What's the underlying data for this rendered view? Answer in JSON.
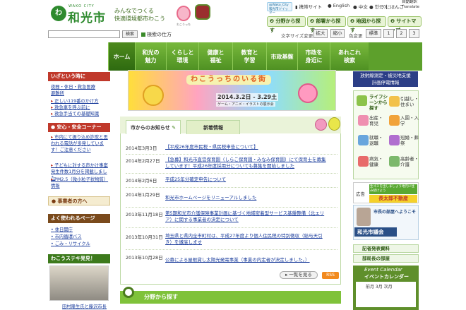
{
  "header": {
    "logo_roman": "WAKO CITY",
    "logo_kanji": "和光市",
    "logo_mark": "わ",
    "tagline_1": "みんなでつくる",
    "tagline_2": "快適環境都市わこう",
    "mascot_caption": "わこうっち"
  },
  "utility": {
    "twitter_1": "@Wako_City",
    "twitter_2": "和光市ツイッター",
    "mobile": "携帯サイト",
    "english": "English",
    "chinese": "中文",
    "korean": "한국어",
    "japanese": "にほんご",
    "translate_1": "自動翻訳",
    "translate_2": "Translate",
    "bunya": "分野から探す",
    "busho": "部署から探す",
    "chizu": "地図から探す",
    "sitemap": "サイトマップ"
  },
  "search": {
    "button": "検索",
    "help": "検索の仕方"
  },
  "font_size": {
    "label": "文字サイズ変更",
    "large": "拡大",
    "small": "縮小"
  },
  "color": {
    "label": "色変更",
    "standard": "標準",
    "opt1": "1",
    "opt2": "2",
    "opt3": "3"
  },
  "nav": [
    "ホーム",
    "和光の\n魅力",
    "くらしと\n環境",
    "健康と\n福祉",
    "教育と\n学習",
    "市政基盤",
    "市政を\n身近に",
    "あれこれ\n検索"
  ],
  "left": {
    "emergency_head": "いざという時に",
    "emergency_links": [
      "夜間・休日・救急医療",
      "避難所"
    ],
    "emergency_items": [
      "正しい119番のかけ方",
      "救急車を呼ぶ前に",
      "救急手当ての基礎知識"
    ],
    "safety_head": "安心・安全コーナー",
    "safety_items": [
      "市内にて振り込め詐欺と思われる電話が多発しています！ご注意ください",
      "子どもに対する声かけ事案発生件数1月分を掲載しました",
      "PM2.5（微小粒子状物質）情報"
    ],
    "business_head": "事業者の方へ",
    "visit_head": "よく使われるページ",
    "visit_items": [
      "休日開庁",
      "市内循環バス",
      "ごみ・リサイクル"
    ],
    "photo_head": "わこうステキ発見！",
    "photo_caption": "田村隆生氏と藤沢市長"
  },
  "banner": {
    "title": "わこうっちのいる街",
    "date": "2014.3.2日 - 3.29土",
    "sub": "ゲーム・アニメ・イラストの展示会"
  },
  "news": {
    "tab1": "市からのお知らせ",
    "tab2": "新着情報",
    "items": [
      {
        "date": "2014年3月3日",
        "text": "【平成26年度市民税・県民税申告について】"
      },
      {
        "date": "2014年2月27日",
        "text": "【急募】和光市直営保育園（しらこ保育園・みなみ保育園）にて保育士を募集しています！平成26年度採用分についても募集を開始しました"
      },
      {
        "date": "2014年2月6日",
        "text": "平成25年分確定申告について"
      },
      {
        "date": "2014年1月29日",
        "text": "和光市ホームページをリニューアルしました"
      },
      {
        "date": "2013年11月18日",
        "text": "第5期和光市介護保険事業計画に基づく地域密着型サービス基盤整備（北エリア）に関する事業者の決定について"
      },
      {
        "date": "2013年10月31日",
        "text": "埼玉県と県内全市町村は、平成27年度より個人住民税の特別徴収（給与天引き）を徹底します"
      },
      {
        "date": "2013年10月28日",
        "text": "公募による屋根貸し太陽光発電事業（事業の内定者が決定しました。）"
      }
    ],
    "more": "一覧を見る",
    "rss": "RSS"
  },
  "field": {
    "title": "分野から探す"
  },
  "right": {
    "disaster_1": "放射線測定・被災地支援",
    "disaster_2": "計画停電情報",
    "life_head": "ライフシーンから探す",
    "life_items": [
      "引越し・住まい",
      "出産・育児",
      "入園・入学",
      "就職・退職",
      "冠婚・葬祭",
      "病気・健康",
      "高齢者・介護"
    ],
    "ad": "広告",
    "ad_banner": "生ゴミを出しましょう地元に住み続けよう",
    "mayor": "長太郎不動産",
    "mayor_room": "市長の部屋へようこそ",
    "council": "和光市議会",
    "links": [
      "記者発表資料",
      "部局長の部屋"
    ],
    "cal_title": "Event Calendar",
    "cal_sub": "イベントカレンダー",
    "cal_nav": "前月 3月 次月"
  }
}
